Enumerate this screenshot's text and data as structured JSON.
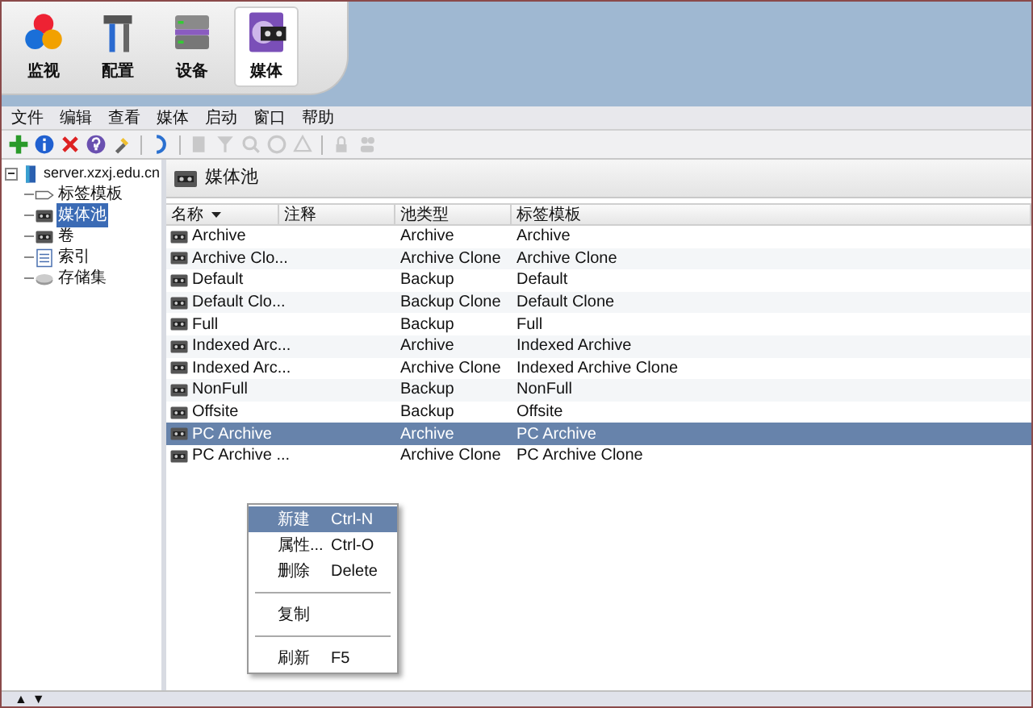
{
  "nav": [
    {
      "label": "监视",
      "selected": false
    },
    {
      "label": "配置",
      "selected": false
    },
    {
      "label": "设备",
      "selected": false
    },
    {
      "label": "媒体",
      "selected": true
    }
  ],
  "menu_bar": [
    "文件",
    "编辑",
    "查看",
    "媒体",
    "启动",
    "窗口",
    "帮助"
  ],
  "toolbar": [
    {
      "kind": "button",
      "disabled": false
    },
    {
      "kind": "button",
      "disabled": false
    },
    {
      "kind": "button",
      "disabled": false
    },
    {
      "kind": "button",
      "disabled": false
    },
    {
      "kind": "button",
      "disabled": false
    },
    {
      "kind": "separator"
    },
    {
      "kind": "button",
      "disabled": false
    },
    {
      "kind": "separator"
    },
    {
      "kind": "button",
      "disabled": true
    },
    {
      "kind": "button",
      "disabled": true
    },
    {
      "kind": "button",
      "disabled": true
    },
    {
      "kind": "button",
      "disabled": true
    },
    {
      "kind": "button",
      "disabled": true
    },
    {
      "kind": "separator"
    },
    {
      "kind": "button",
      "disabled": true
    },
    {
      "kind": "button",
      "disabled": true
    }
  ],
  "tree": {
    "label": "server.xzxj.edu.cn",
    "expanded": true,
    "children": [
      {
        "label": "标签模板",
        "selected": false
      },
      {
        "label": "媒体池",
        "selected": true
      },
      {
        "label": "卷",
        "selected": false
      },
      {
        "label": "索引",
        "selected": false
      },
      {
        "label": "存储集",
        "selected": false
      }
    ]
  },
  "panel": {
    "title": "媒体池"
  },
  "table": {
    "columns": [
      {
        "label": "名称",
        "sorted": true
      },
      {
        "label": "注释",
        "sorted": false
      },
      {
        "label": "池类型",
        "sorted": false
      },
      {
        "label": "标签模板",
        "sorted": false
      }
    ],
    "rows": [
      {
        "name": "Archive",
        "pool_type": "Archive",
        "label_template": "Archive",
        "selected": false
      },
      {
        "name": "Archive Clo...",
        "pool_type": "Archive Clone",
        "label_template": "Archive Clone",
        "selected": false
      },
      {
        "name": "Default",
        "pool_type": "Backup",
        "label_template": "Default",
        "selected": false
      },
      {
        "name": "Default Clo...",
        "pool_type": "Backup Clone",
        "label_template": "Default Clone",
        "selected": false
      },
      {
        "name": "Full",
        "pool_type": "Backup",
        "label_template": "Full",
        "selected": false
      },
      {
        "name": "Indexed Arc...",
        "pool_type": "Archive",
        "label_template": "Indexed Archive",
        "selected": false
      },
      {
        "name": "Indexed Arc...",
        "pool_type": "Archive Clone",
        "label_template": "Indexed Archive Clone",
        "selected": false
      },
      {
        "name": "NonFull",
        "pool_type": "Backup",
        "label_template": "NonFull",
        "selected": false
      },
      {
        "name": "Offsite",
        "pool_type": "Backup",
        "label_template": "Offsite",
        "selected": false
      },
      {
        "name": "PC Archive",
        "pool_type": "Archive",
        "label_template": "PC Archive",
        "selected": true
      },
      {
        "name": "PC Archive ...",
        "pool_type": "Archive Clone",
        "label_template": "PC Archive Clone",
        "selected": false
      }
    ]
  },
  "context_menu": [
    {
      "kind": "item",
      "label": "新建",
      "shortcut": "Ctrl-N",
      "selected": true
    },
    {
      "kind": "item",
      "label": "属性...",
      "shortcut": "Ctrl-O",
      "selected": false
    },
    {
      "kind": "item",
      "label": "删除",
      "shortcut": "Delete",
      "selected": false
    },
    {
      "kind": "separator"
    },
    {
      "kind": "item",
      "label": "复制",
      "selected": false
    },
    {
      "kind": "separator"
    },
    {
      "kind": "item",
      "label": "刷新",
      "shortcut": "F5",
      "selected": false
    }
  ],
  "status_bar": {
    "arrows": [
      "▲",
      "▼"
    ]
  }
}
